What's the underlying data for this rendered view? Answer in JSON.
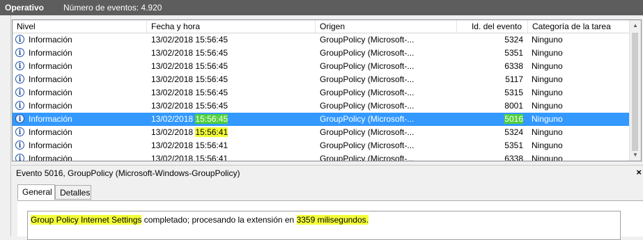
{
  "titlebar": {
    "title": "Operativo",
    "count": "Número de eventos: 4.920"
  },
  "columns": {
    "nivel": "Nivel",
    "fecha": "Fecha y hora",
    "origen": "Origen",
    "id": "Id. del evento",
    "categoria": "Categoría de la tarea"
  },
  "rows": [
    {
      "nivel": "Información",
      "fecha": "13/02/2018 15:56:45",
      "origen": "GroupPolicy (Microsoft-...",
      "id": "5324",
      "categoria": "Ninguno"
    },
    {
      "nivel": "Información",
      "fecha": "13/02/2018 15:56:45",
      "origen": "GroupPolicy (Microsoft-...",
      "id": "5351",
      "categoria": "Ninguno"
    },
    {
      "nivel": "Información",
      "fecha": "13/02/2018 15:56:45",
      "origen": "GroupPolicy (Microsoft-...",
      "id": "6338",
      "categoria": "Ninguno"
    },
    {
      "nivel": "Información",
      "fecha": "13/02/2018 15:56:45",
      "origen": "GroupPolicy (Microsoft-...",
      "id": "5117",
      "categoria": "Ninguno"
    },
    {
      "nivel": "Información",
      "fecha": "13/02/2018 15:56:45",
      "origen": "GroupPolicy (Microsoft-...",
      "id": "5315",
      "categoria": "Ninguno"
    },
    {
      "nivel": "Información",
      "fecha": "13/02/2018 15:56:45",
      "origen": "GroupPolicy (Microsoft-...",
      "id": "8001",
      "categoria": "Ninguno"
    },
    {
      "nivel": "Información",
      "fecha_date": "13/02/2018",
      "fecha_time": "15:56:45",
      "origen": "GroupPolicy (Microsoft-...",
      "id": "5016",
      "categoria": "Ninguno"
    },
    {
      "nivel": "Información",
      "fecha_date": "13/02/2018",
      "fecha_time": "15:56:41",
      "origen": "GroupPolicy (Microsoft-...",
      "id": "5324",
      "categoria": "Ninguno"
    },
    {
      "nivel": "Información",
      "fecha": "13/02/2018 15:56:41",
      "origen": "GroupPolicy (Microsoft-...",
      "id": "5351",
      "categoria": "Ninguno"
    },
    {
      "nivel": "Información",
      "fecha": "13/02/2018 15:56:41",
      "origen": "GroupPolicy (Microsoft-...",
      "id": "6338",
      "categoria": "Ninguno"
    }
  ],
  "detail": {
    "header": "Evento 5016, GroupPolicy (Microsoft-Windows-GroupPolicy)",
    "close": "×",
    "tabs": [
      "General",
      "Detalles"
    ],
    "message_part1": "Group Policy Internet Settings",
    "message_part2": " completado; procesando la extensión en ",
    "message_part3": "3359 milisegundos."
  },
  "icons": {
    "info": "info-icon",
    "close": "close-icon"
  },
  "colors": {
    "titlebar": "#5d5d5d",
    "selection": "#3399ff",
    "highlight_yellow": "#f4ff3a",
    "highlight_green": "#4fd03a"
  }
}
